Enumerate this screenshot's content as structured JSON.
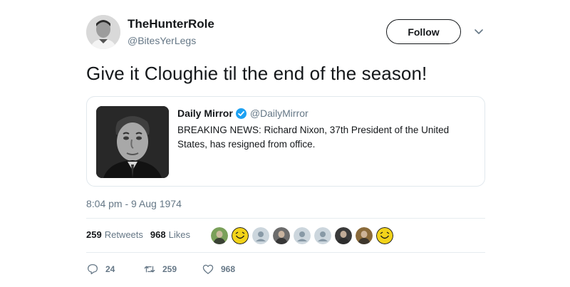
{
  "author": {
    "display_name": "TheHunterRole",
    "handle": "@BitesYerLegs",
    "follow_label": "Follow"
  },
  "tweet": {
    "text": "Give it Cloughie til the end of the season!",
    "timestamp": "8:04 pm - 9 Aug 1974"
  },
  "quoted_tweet": {
    "name": "Daily Mirror",
    "handle": "@DailyMirror",
    "text": "BREAKING NEWS: Richard Nixon, 37th President of the United States, has resigned from office."
  },
  "stats": {
    "retweets_count": "259",
    "retweets_label": "Retweets",
    "likes_count": "968",
    "likes_label": "Likes"
  },
  "likers": [
    {
      "kind": "photo",
      "color": "#7aa05a"
    },
    {
      "kind": "smiley",
      "color": "#f2d31a"
    },
    {
      "kind": "default",
      "color": "#ccd6dd"
    },
    {
      "kind": "photo",
      "color": "#6c6c6c"
    },
    {
      "kind": "default",
      "color": "#ccd6dd"
    },
    {
      "kind": "default",
      "color": "#ccd6dd"
    },
    {
      "kind": "photo",
      "color": "#3a3a3a"
    },
    {
      "kind": "photo",
      "color": "#8a6a3a"
    },
    {
      "kind": "smiley",
      "color": "#f2d31a"
    }
  ],
  "actions": {
    "reply_count": "24",
    "retweet_count": "259",
    "like_count": "968"
  },
  "colors": {
    "verified": "#1da1f2",
    "secondary_text": "#657786",
    "border": "#e1e8ed"
  }
}
